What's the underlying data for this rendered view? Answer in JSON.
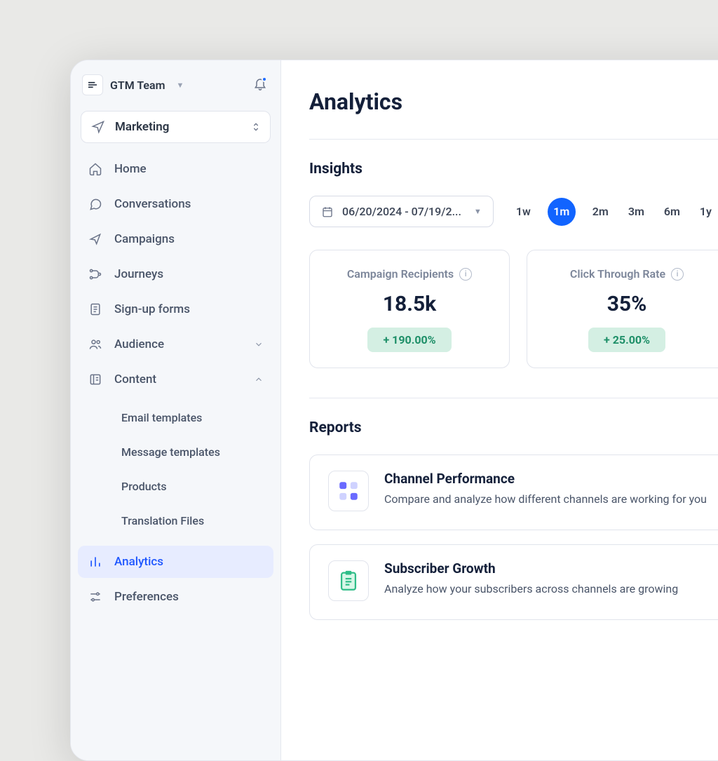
{
  "header": {
    "team_name": "GTM Team"
  },
  "workspace": {
    "name": "Marketing"
  },
  "nav": {
    "home": "Home",
    "conversations": "Conversations",
    "campaigns": "Campaigns",
    "journeys": "Journeys",
    "signup_forms": "Sign-up forms",
    "audience": "Audience",
    "content": "Content",
    "analytics": "Analytics",
    "preferences": "Preferences"
  },
  "content_sub": {
    "email_templates": "Email templates",
    "message_templates": "Message templates",
    "products": "Products",
    "translation_files": "Translation Files"
  },
  "page": {
    "title": "Analytics"
  },
  "insights": {
    "title": "Insights",
    "date_range": "06/20/2024 - 07/19/2...",
    "ranges": [
      "1w",
      "1m",
      "2m",
      "3m",
      "6m",
      "1y"
    ],
    "active_range": "1m"
  },
  "cards": [
    {
      "title": "Campaign Recipients",
      "value": "18.5k",
      "delta": "+ 190.00%"
    },
    {
      "title": "Click Through Rate",
      "value": "35%",
      "delta": "+ 25.00%"
    }
  ],
  "reports": {
    "title": "Reports",
    "items": [
      {
        "title": "Channel Performance",
        "desc": "Compare and analyze how different channels are working for you"
      },
      {
        "title": "Subscriber Growth",
        "desc": "Analyze how your subscribers across channels are growing"
      }
    ]
  }
}
